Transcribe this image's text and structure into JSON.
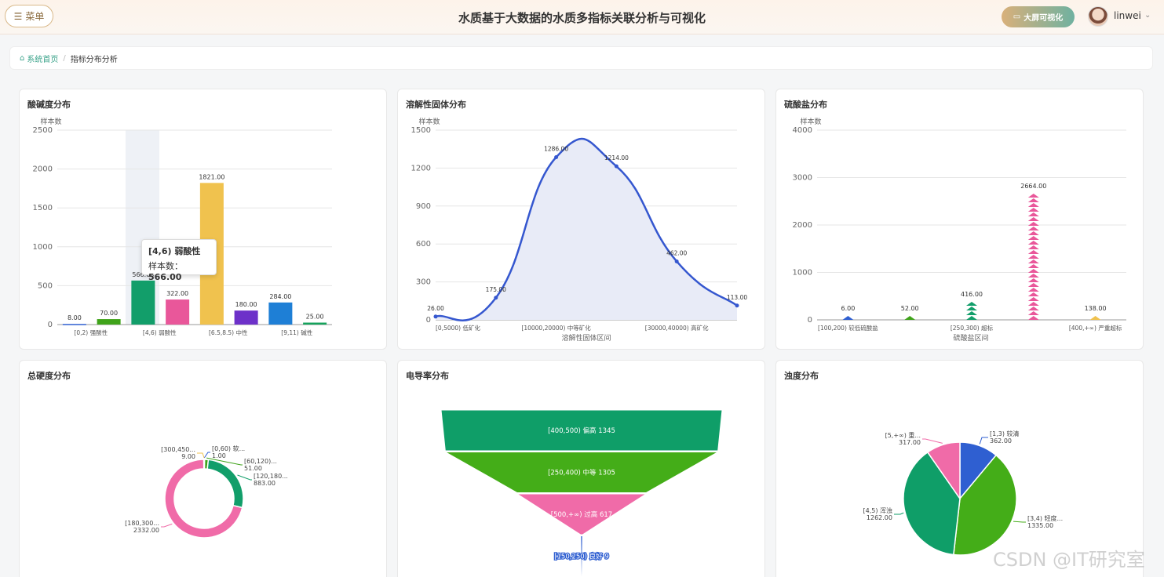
{
  "header": {
    "menu_label": "菜单",
    "title": "水质基于大数据的水质多指标关联分析与可视化",
    "bigscreen_label": "大屏可视化",
    "username": "linwei"
  },
  "breadcrumb": {
    "home": "系统首页",
    "current": "指标分布分析"
  },
  "cards": {
    "ph": {
      "title": "酸碱度分布"
    },
    "tds": {
      "title": "溶解性固体分布"
    },
    "sulfate": {
      "title": "硫酸盐分布"
    },
    "hardness": {
      "title": "总硬度分布"
    },
    "conductivity": {
      "title": "电导率分布"
    },
    "turbidity": {
      "title": "浊度分布"
    }
  },
  "tooltip": {
    "title": "[4,6) 弱酸性",
    "label": "样本数：",
    "value": "566.00"
  },
  "watermark": "CSDN @IT研究室",
  "chart_data": [
    {
      "id": "ph",
      "type": "bar",
      "title": "酸碱度分布",
      "ylabel": "样本数",
      "ylim": [
        0,
        2500
      ],
      "yticks": [
        "0",
        "500",
        "1000",
        "1500",
        "2000",
        "2500"
      ],
      "xtick_labels": [
        "[0,2) 强酸性",
        "[4,6) 弱酸性",
        "[6.5,8.5) 中性",
        "[9,11) 碱性"
      ],
      "bars": [
        {
          "value": 8,
          "label": "8.00",
          "color": "#2f5fd1"
        },
        {
          "value": 70,
          "label": "70.00",
          "color": "#3fa31a"
        },
        {
          "value": 566,
          "label": "566.00",
          "color": "#129e6a"
        },
        {
          "value": 322,
          "label": "322.00",
          "color": "#e9579a"
        },
        {
          "value": 1821,
          "label": "1821.00",
          "color": "#f0c24e"
        },
        {
          "value": 180,
          "label": "180.00",
          "color": "#6d31c9"
        },
        {
          "value": 284,
          "label": "284.00",
          "color": "#1e7fd6"
        },
        {
          "value": 25,
          "label": "25.00",
          "color": "#16a25c"
        }
      ]
    },
    {
      "id": "tds",
      "type": "area",
      "title": "溶解性固体分布",
      "ylabel": "样本数",
      "xlabel": "溶解性固体区间",
      "ylim": [
        0,
        1500
      ],
      "yticks": [
        "0",
        "300",
        "600",
        "900",
        "1200",
        "1500"
      ],
      "xtick_labels": [
        "[0,5000) 低矿化",
        "[10000,20000) 中等矿化",
        "[30000,40000) 高矿化"
      ],
      "points": [
        {
          "value": 26,
          "label": "26.00"
        },
        {
          "value": 175,
          "label": "175.00"
        },
        {
          "value": 1286,
          "label": "1286.00"
        },
        {
          "value": 1214,
          "label": "1214.00"
        },
        {
          "value": 462,
          "label": "462.00"
        },
        {
          "value": 113,
          "label": "113.00"
        }
      ]
    },
    {
      "id": "sulfate",
      "type": "bar",
      "title": "硫酸盐分布",
      "ylabel": "样本数",
      "xlabel": "硫酸盐区间",
      "ylim": [
        0,
        4000
      ],
      "yticks": [
        "0",
        "1000",
        "2000",
        "3000",
        "4000"
      ],
      "xtick_labels": [
        "[100,200) 较低硫酸盐",
        "[250,300) 超标",
        "[400,+∞) 严重超标"
      ],
      "bars": [
        {
          "value": 6,
          "label": "6.00",
          "color": "#2f5fd1"
        },
        {
          "value": 52,
          "label": "52.00",
          "color": "#3fa31a"
        },
        {
          "value": 416,
          "label": "416.00",
          "color": "#129e6a"
        },
        {
          "value": 2664,
          "label": "2664.00",
          "color": "#e9579a"
        },
        {
          "value": 138,
          "label": "138.00",
          "color": "#f0c24e"
        }
      ]
    },
    {
      "id": "hardness",
      "type": "pie",
      "title": "总硬度分布",
      "slices": [
        {
          "label": "[0,60) 软...",
          "value": 1,
          "value_label": "1.00",
          "color": "#2f5fd1"
        },
        {
          "label": "[60,120)...",
          "value": 51,
          "value_label": "51.00",
          "color": "#3fa31a"
        },
        {
          "label": "[120,180...",
          "value": 883,
          "value_label": "883.00",
          "color": "#129e6a"
        },
        {
          "label": "[180,300...",
          "value": 2332,
          "value_label": "2332.00",
          "color": "#f06ba8"
        },
        {
          "label": "[300,450...",
          "value": 9,
          "value_label": "9.00",
          "color": "#f0c24e"
        }
      ]
    },
    {
      "id": "conductivity",
      "type": "funnel",
      "title": "电导率分布",
      "stages": [
        {
          "label": "[400,500) 偏高 1345",
          "value": 1345,
          "color": "#0f9e68"
        },
        {
          "label": "[250,400) 中等 1305",
          "value": 1305,
          "color": "#44ad18"
        },
        {
          "label": "[500,+∞) 过高 617",
          "value": 617,
          "color": "#f06ba8"
        },
        {
          "label": "[150,250) 良好 9",
          "value": 9,
          "color": "#2f5fd1"
        }
      ]
    },
    {
      "id": "turbidity",
      "type": "pie",
      "title": "浊度分布",
      "slices": [
        {
          "label": "[1,3) 较清",
          "value": 362,
          "value_label": "362.00",
          "color": "#2f5fd1"
        },
        {
          "label": "[3,4) 轻度...",
          "value": 1335,
          "value_label": "1335.00",
          "color": "#44ad18"
        },
        {
          "label": "[4,5) 浑浊",
          "value": 1262,
          "value_label": "1262.00",
          "color": "#0f9e68"
        },
        {
          "label": "[5,+∞) 重...",
          "value": 317,
          "value_label": "317.00",
          "color": "#f06ba8"
        }
      ]
    }
  ]
}
